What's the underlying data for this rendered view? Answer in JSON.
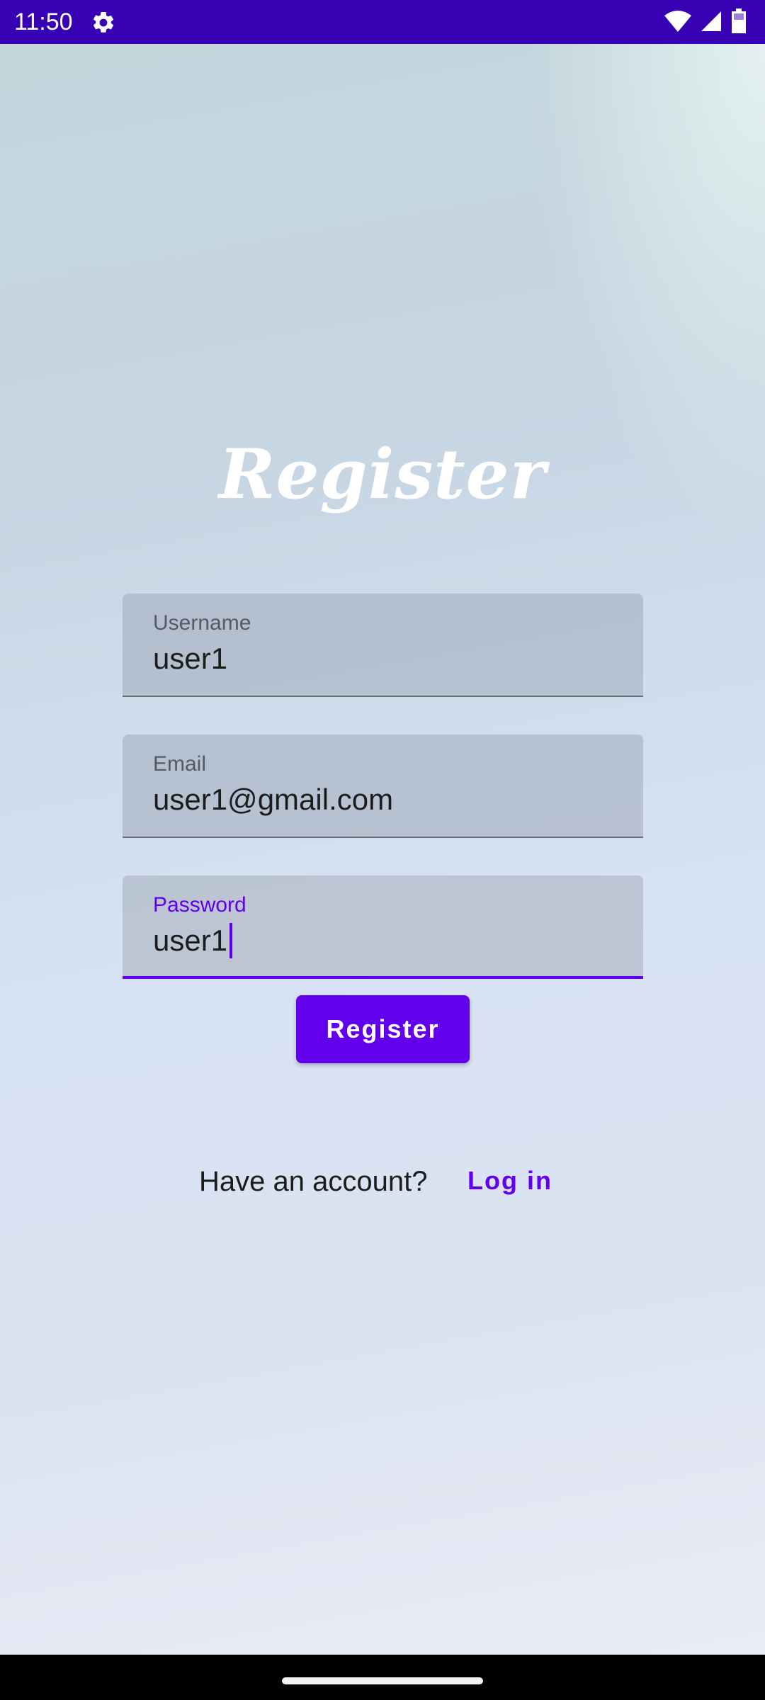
{
  "status_bar": {
    "time": "11:50",
    "icons": [
      "settings-gear-icon",
      "wifi-icon",
      "cell-signal-icon",
      "battery-icon"
    ]
  },
  "title": "Register",
  "form": {
    "username": {
      "label": "Username",
      "value": "user1"
    },
    "email": {
      "label": "Email",
      "value": "user1@gmail.com"
    },
    "password": {
      "label": "Password",
      "value": "user1",
      "focused": true
    }
  },
  "register_button": "Register",
  "footer": {
    "prompt": "Have an account?",
    "login_link": "Log in"
  },
  "colors": {
    "accent": "#6200ee",
    "status_bar": "#3700b3"
  }
}
